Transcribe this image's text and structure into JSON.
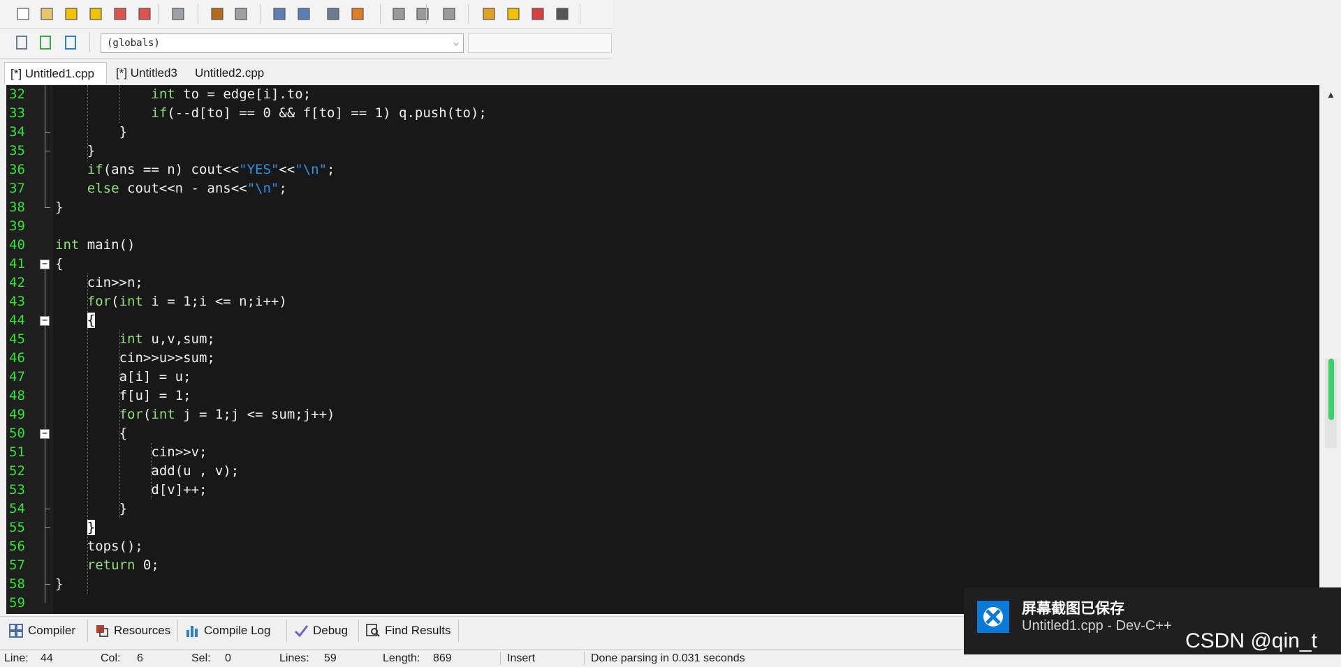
{
  "toolbar": {
    "row1_icons": [
      "new-file-icon",
      "open-file-icon",
      "save-icon",
      "save-all-icon",
      "close-icon",
      "close-all-icon",
      "print-icon",
      "undo-icon",
      "redo-icon",
      "find-icon",
      "replace-icon",
      "indent-icon",
      "unindent-icon",
      "bookmark-left-icon",
      "bookmark-right-icon",
      "toggle-comment-icon",
      "layout-grid-icon",
      "window-icon",
      "color-grid-icon",
      "tiles-icon"
    ],
    "row2_icons": [
      "new-class-icon",
      "add-file-icon",
      "project-icon"
    ],
    "scope_select": "(globals)"
  },
  "editor_tabs": [
    {
      "label": "[*] Untitled1.cpp",
      "active": true
    },
    {
      "label": "[*] Untitled3",
      "active": false
    },
    {
      "label": "Untitled2.cpp",
      "active": false
    }
  ],
  "code_lines": [
    {
      "n": "32",
      "html": "<span class='kw'>int</span> to = edge[i].to;"
    },
    {
      "n": "33",
      "html": "<span class='kw'>if</span>(--d[to] == 0 &amp;&amp; f[to] == 1) q.push(to);"
    },
    {
      "n": "34",
      "html": "}"
    },
    {
      "n": "35",
      "html": "}"
    },
    {
      "n": "36",
      "html": "<span class='kw'>if</span>(ans == n) cout&lt;&lt;<span class='str'>\"YES\"</span>&lt;&lt;<span class='str'>\"\\n\"</span>;"
    },
    {
      "n": "37",
      "html": "<span class='kw'>else</span> cout&lt;&lt;n - ans&lt;&lt;<span class='str'>\"\\n\"</span>;"
    },
    {
      "n": "38",
      "html": "}"
    },
    {
      "n": "39",
      "html": ""
    },
    {
      "n": "40",
      "html": "<span class='kw'>int</span> main()"
    },
    {
      "n": "41",
      "html": "{"
    },
    {
      "n": "42",
      "html": "cin&gt;&gt;n;"
    },
    {
      "n": "43",
      "html": "<span class='kw'>for</span>(<span class='kw'>int</span> i = 1;i &lt;= n;i++)"
    },
    {
      "n": "44",
      "html": "<span class='brhl'>{</span>"
    },
    {
      "n": "45",
      "html": "<span class='kw'>int</span> u,v,sum;"
    },
    {
      "n": "46",
      "html": "cin&gt;&gt;u&gt;&gt;sum;"
    },
    {
      "n": "47",
      "html": "a[i] = u;"
    },
    {
      "n": "48",
      "html": "f[u] = 1;"
    },
    {
      "n": "49",
      "html": "<span class='kw'>for</span>(<span class='kw'>int</span> j = 1;j &lt;= sum;j++)"
    },
    {
      "n": "50",
      "html": "{"
    },
    {
      "n": "51",
      "html": "cin&gt;&gt;v;"
    },
    {
      "n": "52",
      "html": "add(u , v);"
    },
    {
      "n": "53",
      "html": "d[v]++;"
    },
    {
      "n": "54",
      "html": "}"
    },
    {
      "n": "55",
      "html": "<span class='brhl'>}</span>"
    },
    {
      "n": "56",
      "html": "tops();"
    },
    {
      "n": "57",
      "html": "<span class='kw'>return</span> 0;"
    },
    {
      "n": "58",
      "html": "}"
    },
    {
      "n": "59",
      "html": ""
    }
  ],
  "bottom_tabs": [
    {
      "label": "Compiler",
      "icon": "compiler-grid-icon"
    },
    {
      "label": "Resources",
      "icon": "resources-icon"
    },
    {
      "label": "Compile Log",
      "icon": "compile-log-chart-icon"
    },
    {
      "label": "Debug",
      "icon": "debug-check-icon"
    },
    {
      "label": "Find Results",
      "icon": "find-results-icon"
    }
  ],
  "status": {
    "line_label": "Line:",
    "line_value": "44",
    "col_label": "Col:",
    "col_value": "6",
    "sel_label": "Sel:",
    "sel_value": "0",
    "lines_label": "Lines:",
    "lines_value": "59",
    "length_label": "Length:",
    "length_value": "869",
    "mode": "Insert",
    "message": "Done parsing in 0.031 seconds"
  },
  "toast": {
    "title": "屏幕截图已保存",
    "body": "Untitled1.cpp - Dev-C++",
    "icon": "xbox-icon"
  },
  "watermark": "CSDN @qin_t",
  "colors": {
    "line_number": "#33e333",
    "keyword": "#8fe07a",
    "string": "#2f8fe8",
    "editor_bg": "#181818",
    "toast_bg": "#1f1f1f",
    "toast_icon": "#0a7ad8"
  }
}
